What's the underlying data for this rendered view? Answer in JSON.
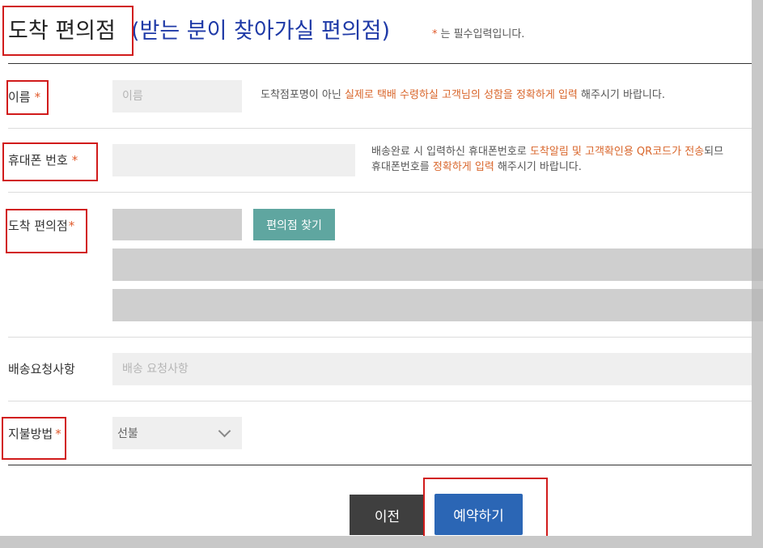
{
  "header": {
    "title_main": "도착 편의점",
    "title_sub": "(받는 분이 찾아가실 편의점)",
    "required_star": "*",
    "required_note": "는 필수입력입니다."
  },
  "name_row": {
    "label": "이름",
    "star": "*",
    "placeholder": "이름",
    "help_prefix": "도착점포명이 아닌 ",
    "help_emphasis": "실제로 택배 수령하실 고객님의 성함을 정확하게 입력",
    "help_suffix": " 해주시기 바랍니다."
  },
  "phone_row": {
    "label": "휴대폰 번호",
    "star": "*",
    "help_line1_prefix": "배송완료 시 입력하신 휴대폰번호로 ",
    "help_line1_emphasis": "도착알림 및 고객확인용 QR코드가 전송",
    "help_line1_suffix": "되므",
    "help_line2_prefix": "휴대폰번호를 ",
    "help_line2_emphasis": "정확하게 입력",
    "help_line2_suffix": " 해주시기 바랍니다."
  },
  "store_row": {
    "label": "도착 편의점",
    "star": "*",
    "find_button": "편의점 찾기"
  },
  "request_row": {
    "label": "배송요청사항",
    "placeholder": "배송 요청사항"
  },
  "payment_row": {
    "label": "지불방법",
    "star": "*",
    "selected": "선불"
  },
  "actions": {
    "prev": "이전",
    "reserve": "예약하기"
  },
  "colors": {
    "accent_blue": "#2b66b5",
    "title_blue": "#1f3aa7",
    "find_teal": "#5fa6a0",
    "emphasis_orange": "#d9662b",
    "highlight_red": "#d11b1b"
  }
}
